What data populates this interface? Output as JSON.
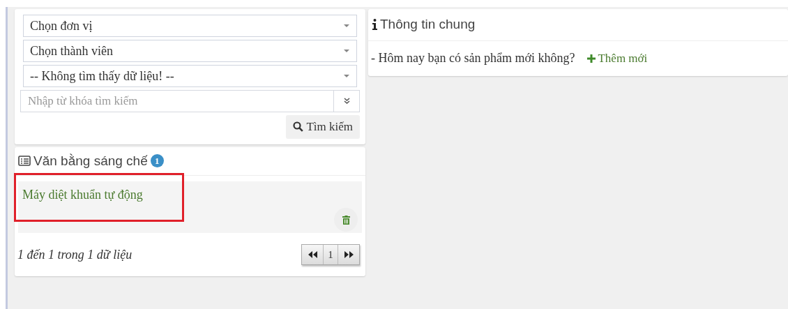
{
  "filters": {
    "selects": [
      {
        "value": "Chọn đơn vị"
      },
      {
        "value": "Chọn thành viên"
      },
      {
        "value": "-- Không tìm thấy dữ liệu! --"
      }
    ],
    "search": {
      "placeholder": "Nhập từ khóa tìm kiếm"
    },
    "search_button": "Tìm kiếm"
  },
  "patents": {
    "title": "Văn bằng sáng chế",
    "count": "1",
    "items": [
      {
        "name": "Máy diệt khuẩn tự động",
        "highlighted": true
      }
    ],
    "summary": "1 đến 1 trong 1 dữ liệu",
    "pager": {
      "current": "1"
    }
  },
  "info": {
    "title": "Thông tin chung",
    "question": "- Hôm nay bạn có sản phẩm mới không?",
    "add_link": "Thêm mới"
  }
}
